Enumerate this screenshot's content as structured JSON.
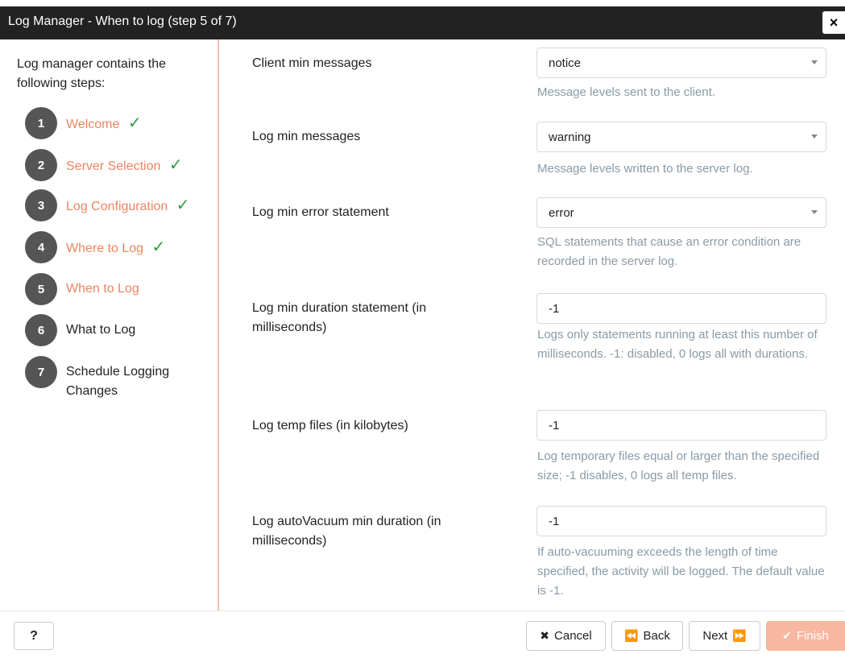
{
  "dialog": {
    "title": "Log Manager - When to log (step 5 of 7)",
    "close_label": "×"
  },
  "sidebar": {
    "intro": "Log manager contains the following steps:",
    "steps": [
      {
        "num": "1",
        "label": "Welcome",
        "status": "completed",
        "check": "✓"
      },
      {
        "num": "2",
        "label": "Server Selection",
        "status": "completed",
        "check": "✓"
      },
      {
        "num": "3",
        "label": "Log Configuration",
        "status": "completed",
        "check": "✓"
      },
      {
        "num": "4",
        "label": "Where to Log",
        "status": "completed",
        "check": "✓"
      },
      {
        "num": "5",
        "label": "When to Log",
        "status": "current"
      },
      {
        "num": "6",
        "label": "What to Log",
        "status": "pending"
      },
      {
        "num": "7",
        "label": "Schedule Logging Changes",
        "status": "pending"
      }
    ]
  },
  "form": {
    "fields": [
      {
        "label": "Client min messages",
        "value": "notice",
        "type": "select",
        "help": "Message levels sent to the client."
      },
      {
        "label": "Log min messages",
        "value": "warning",
        "type": "select",
        "help": "Message levels written to the server log."
      },
      {
        "label": "Log min error statement",
        "value": "error",
        "type": "select",
        "help": "SQL statements that cause an error condition are recorded in the server log."
      },
      {
        "label": "Log min duration statement (in milliseconds)",
        "value": "-1",
        "type": "text",
        "help": "Logs only statements running at least this number of milliseconds. -1: disabled, 0 logs all with durations."
      },
      {
        "label": "Log temp files (in kilobytes)",
        "value": "-1",
        "type": "text",
        "help": "Log temporary files equal or larger than the specified size; -1 disables, 0 logs all temp files."
      },
      {
        "label": "Log autoVacuum min duration (in milliseconds)",
        "value": "-1",
        "type": "text",
        "help": "If auto-vacuuming exceeds the length of time specified, the activity will be logged. The default value is -1."
      }
    ]
  },
  "footer": {
    "help_label": "?",
    "cancel_icon": "✖",
    "cancel_label": "Cancel",
    "back_icon": "⏪",
    "back_label": "Back",
    "next_label": "Next",
    "next_icon": "⏩",
    "finish_icon": "✔",
    "finish_label": "Finish"
  },
  "colors": {
    "accent": "#f0845e",
    "check": "#2e9c3a",
    "titlebar": "#222222",
    "finish_disabled": "#f8b79f"
  }
}
